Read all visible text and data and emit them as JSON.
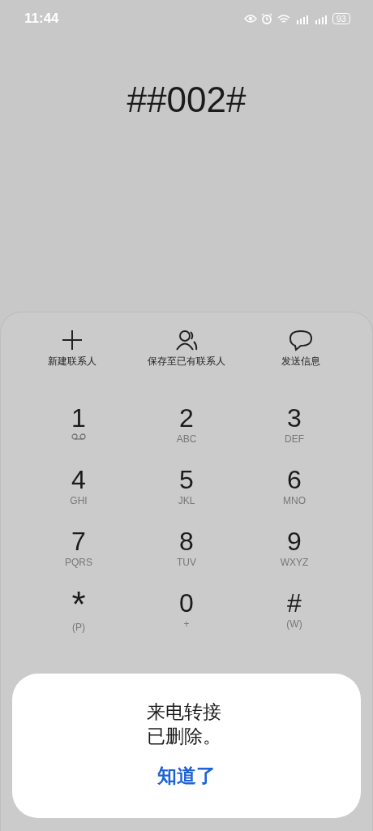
{
  "status_bar": {
    "time": "11:44",
    "battery": "93"
  },
  "dialed_number": "##002#",
  "actions": [
    {
      "kind": "add",
      "label": "新建联系人"
    },
    {
      "kind": "contact",
      "label": "保存至已有联系人"
    },
    {
      "kind": "message",
      "label": "发送信息"
    }
  ],
  "keys": [
    {
      "digit": "1",
      "kind": "voicemail"
    },
    {
      "digit": "2",
      "letters": "ABC"
    },
    {
      "digit": "3",
      "letters": "DEF"
    },
    {
      "digit": "4",
      "letters": "GHI"
    },
    {
      "digit": "5",
      "letters": "JKL"
    },
    {
      "digit": "6",
      "letters": "MNO"
    },
    {
      "digit": "7",
      "letters": "PQRS"
    },
    {
      "digit": "8",
      "letters": "TUV"
    },
    {
      "digit": "9",
      "letters": "WXYZ"
    },
    {
      "digit": "*",
      "letters": "(P)"
    },
    {
      "digit": "0",
      "letters": "+"
    },
    {
      "digit": "#",
      "letters": "(W)"
    }
  ],
  "dialog": {
    "message": "来电转接已删除。",
    "button": "知道了"
  }
}
